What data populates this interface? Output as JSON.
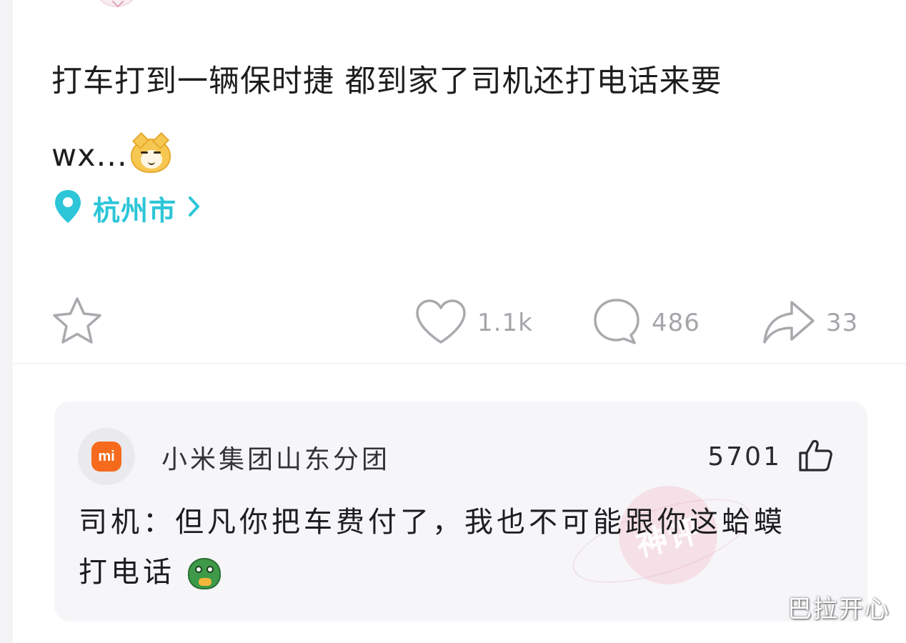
{
  "post": {
    "text_line1": "打车打到一辆保时捷 都到家了司机还打电话来要",
    "text_line2": "wx...",
    "emoji": "smug-cat-emoji",
    "location": {
      "label": "杭州市",
      "icon": "location-pin-icon",
      "chevron": "›",
      "color": "#2cc6d8"
    },
    "actions": {
      "favorite_icon": "star-icon",
      "like_icon": "heart-icon",
      "like_count": "1.1k",
      "comment_icon": "speech-bubble-icon",
      "comment_count": "486",
      "share_icon": "share-arrow-icon",
      "share_count": "33"
    }
  },
  "comment": {
    "avatar_logo_text": "mi",
    "avatar_color": "#f56a1c",
    "username": "小米集团山东分团",
    "like_count": "5701",
    "like_icon": "thumbs-up-icon",
    "text_line1": "司机：但凡你把车费付了，我也不可能跟你这蛤蟆",
    "text_line2": "打电话",
    "emoji": "toad-emoji",
    "stamp_text": "神评"
  },
  "watermark": "巴拉开心"
}
